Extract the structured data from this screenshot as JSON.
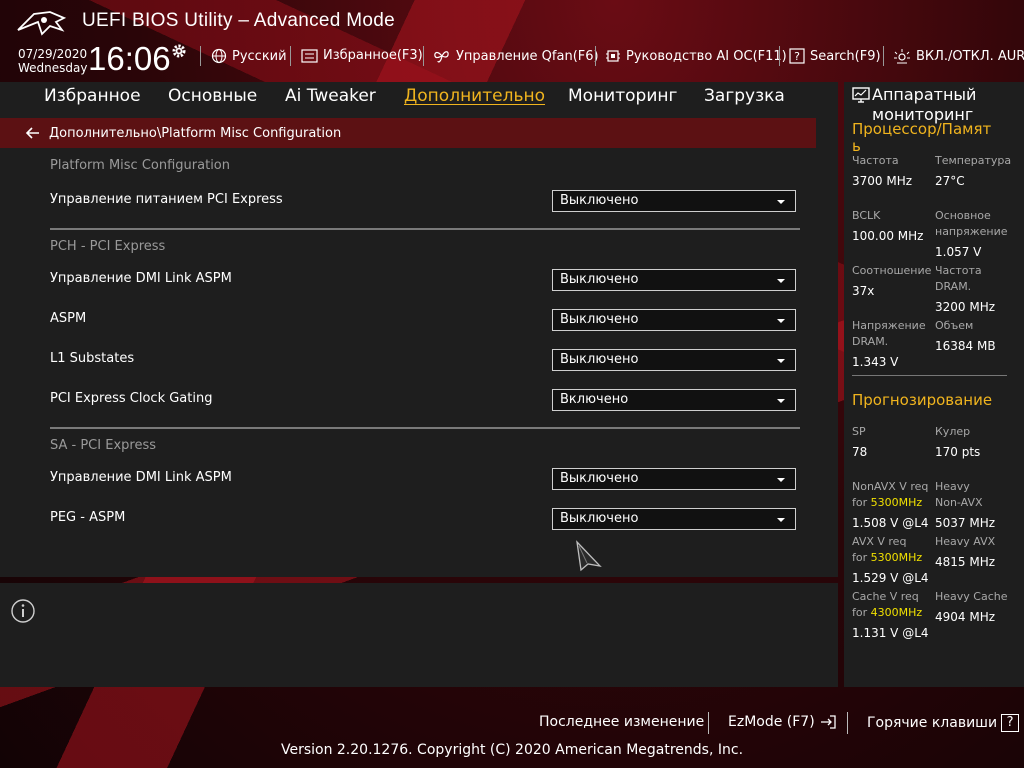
{
  "header": {
    "title": "UEFI BIOS Utility – Advanced Mode",
    "date": "07/29/2020",
    "weekday": "Wednesday",
    "time": "16:06",
    "items": {
      "language": "Русский",
      "favorites": "Избранное(F3)",
      "qfan": "Управление Qfan(F6)",
      "ai_oc": "Руководство AI OC(F11)",
      "search": "Search(F9)",
      "aura": "ВКЛ./ОТКЛ. AURA("
    }
  },
  "tabs": {
    "favorites": "Избранное",
    "main": "Основные",
    "ai_tweaker": "Ai Tweaker",
    "advanced": "Дополнительно",
    "monitor": "Мониторинг",
    "boot": "Загрузка"
  },
  "breadcrumb": "Дополнительно\\Platform Misc Configuration",
  "settings": {
    "section_platform": "Platform Misc Configuration",
    "pcie_power_label": "Управление питанием PCI Express",
    "pcie_power_value": "Выключено",
    "section_pch": "PCH - PCI Express",
    "pch_dmi_aspm_label": "Управление DMI Link ASPM",
    "pch_dmi_aspm_value": "Выключено",
    "aspm_label": "ASPM",
    "aspm_value": "Выключено",
    "l1_label": "L1 Substates",
    "l1_value": "Выключено",
    "clock_gating_label": "PCI Express Clock Gating",
    "clock_gating_value": "Включено",
    "section_sa": "SA - PCI Express",
    "sa_dmi_aspm_label": "Управление DMI Link ASPM",
    "sa_dmi_aspm_value": "Выключено",
    "peg_aspm_label": "PEG - ASPM",
    "peg_aspm_value": "Выключено"
  },
  "monitor": {
    "title_line1": "Аппаратный",
    "title_line2": "мониторинг",
    "cpu_mem_heading_1": "Процессор/Памят",
    "cpu_mem_heading_2": "ь",
    "freq_label": "Частота",
    "freq_value": "3700 MHz",
    "temp_label": "Температура",
    "temp_value": "27°C",
    "bclk_label": "BCLK",
    "bclk_value": "100.00 MHz",
    "core_volt_label_1": "Основное",
    "core_volt_label_2": "напряжение",
    "core_volt_value": "1.057 V",
    "ratio_label": "Соотношение",
    "ratio_value": "37x",
    "dram_freq_label_1": "Частота",
    "dram_freq_label_2": "DRAM.",
    "dram_freq_value": "3200 MHz",
    "dram_volt_label_1": "Напряжение",
    "dram_volt_label_2": "DRAM.",
    "dram_volt_value": "1.343 V",
    "capacity_label": "Объем",
    "capacity_value": "16384 MB",
    "prediction_heading": "Прогнозирование",
    "sp_label": "SP",
    "sp_value": "78",
    "cooler_label": "Кулер",
    "cooler_value": "170 pts",
    "nonavx_label_1": "NonAVX V req",
    "nonavx_label_2a": "for ",
    "nonavx_label_2b": "5300MHz",
    "nonavx_value": "1.508 V @L4",
    "heavy_nonavx_label_1": "Heavy",
    "heavy_nonavx_label_2": "Non-AVX",
    "heavy_nonavx_value": "5037 MHz",
    "avx_label_1": "AVX V req",
    "avx_label_2a": "for ",
    "avx_label_2b": "5300MHz",
    "avx_value": "1.529 V @L4",
    "heavy_avx_label": "Heavy AVX",
    "heavy_avx_value": "4815 MHz",
    "cache_label_1": "Cache V req",
    "cache_label_2a": "for ",
    "cache_label_2b": "4300MHz",
    "cache_value": "1.131 V @L4",
    "heavy_cache_label": "Heavy Cache",
    "heavy_cache_value": "4904 MHz"
  },
  "footer": {
    "last_modified": "Последнее изменение",
    "ezmode": "EzMode (F7)",
    "hotkeys": "Горячие клавиши",
    "hotkeys_key": "?",
    "version": "Version 2.20.1276. Copyright (C) 2020 American Megatrends, Inc."
  },
  "colors": {
    "accent": "#f0b41e",
    "highlight_freq": "#f0e000",
    "breadcrumb_bg": "#5c1113",
    "panel_bg": "#1e1e1e"
  }
}
